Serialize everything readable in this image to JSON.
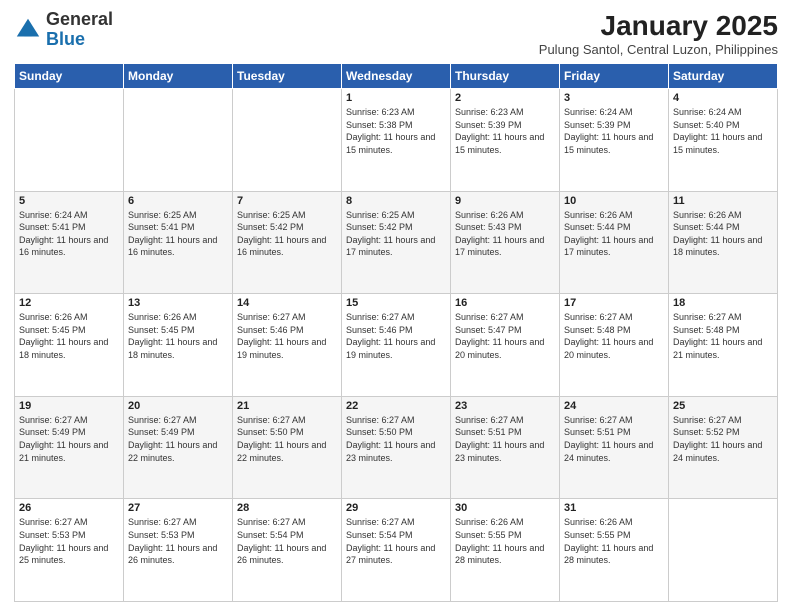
{
  "header": {
    "logo_general": "General",
    "logo_blue": "Blue",
    "month_title": "January 2025",
    "location": "Pulung Santol, Central Luzon, Philippines"
  },
  "weekdays": [
    "Sunday",
    "Monday",
    "Tuesday",
    "Wednesday",
    "Thursday",
    "Friday",
    "Saturday"
  ],
  "weeks": [
    [
      {
        "day": "",
        "info": ""
      },
      {
        "day": "",
        "info": ""
      },
      {
        "day": "",
        "info": ""
      },
      {
        "day": "1",
        "info": "Sunrise: 6:23 AM\nSunset: 5:38 PM\nDaylight: 11 hours and 15 minutes."
      },
      {
        "day": "2",
        "info": "Sunrise: 6:23 AM\nSunset: 5:39 PM\nDaylight: 11 hours and 15 minutes."
      },
      {
        "day": "3",
        "info": "Sunrise: 6:24 AM\nSunset: 5:39 PM\nDaylight: 11 hours and 15 minutes."
      },
      {
        "day": "4",
        "info": "Sunrise: 6:24 AM\nSunset: 5:40 PM\nDaylight: 11 hours and 15 minutes."
      }
    ],
    [
      {
        "day": "5",
        "info": "Sunrise: 6:24 AM\nSunset: 5:41 PM\nDaylight: 11 hours and 16 minutes."
      },
      {
        "day": "6",
        "info": "Sunrise: 6:25 AM\nSunset: 5:41 PM\nDaylight: 11 hours and 16 minutes."
      },
      {
        "day": "7",
        "info": "Sunrise: 6:25 AM\nSunset: 5:42 PM\nDaylight: 11 hours and 16 minutes."
      },
      {
        "day": "8",
        "info": "Sunrise: 6:25 AM\nSunset: 5:42 PM\nDaylight: 11 hours and 17 minutes."
      },
      {
        "day": "9",
        "info": "Sunrise: 6:26 AM\nSunset: 5:43 PM\nDaylight: 11 hours and 17 minutes."
      },
      {
        "day": "10",
        "info": "Sunrise: 6:26 AM\nSunset: 5:44 PM\nDaylight: 11 hours and 17 minutes."
      },
      {
        "day": "11",
        "info": "Sunrise: 6:26 AM\nSunset: 5:44 PM\nDaylight: 11 hours and 18 minutes."
      }
    ],
    [
      {
        "day": "12",
        "info": "Sunrise: 6:26 AM\nSunset: 5:45 PM\nDaylight: 11 hours and 18 minutes."
      },
      {
        "day": "13",
        "info": "Sunrise: 6:26 AM\nSunset: 5:45 PM\nDaylight: 11 hours and 18 minutes."
      },
      {
        "day": "14",
        "info": "Sunrise: 6:27 AM\nSunset: 5:46 PM\nDaylight: 11 hours and 19 minutes."
      },
      {
        "day": "15",
        "info": "Sunrise: 6:27 AM\nSunset: 5:46 PM\nDaylight: 11 hours and 19 minutes."
      },
      {
        "day": "16",
        "info": "Sunrise: 6:27 AM\nSunset: 5:47 PM\nDaylight: 11 hours and 20 minutes."
      },
      {
        "day": "17",
        "info": "Sunrise: 6:27 AM\nSunset: 5:48 PM\nDaylight: 11 hours and 20 minutes."
      },
      {
        "day": "18",
        "info": "Sunrise: 6:27 AM\nSunset: 5:48 PM\nDaylight: 11 hours and 21 minutes."
      }
    ],
    [
      {
        "day": "19",
        "info": "Sunrise: 6:27 AM\nSunset: 5:49 PM\nDaylight: 11 hours and 21 minutes."
      },
      {
        "day": "20",
        "info": "Sunrise: 6:27 AM\nSunset: 5:49 PM\nDaylight: 11 hours and 22 minutes."
      },
      {
        "day": "21",
        "info": "Sunrise: 6:27 AM\nSunset: 5:50 PM\nDaylight: 11 hours and 22 minutes."
      },
      {
        "day": "22",
        "info": "Sunrise: 6:27 AM\nSunset: 5:50 PM\nDaylight: 11 hours and 23 minutes."
      },
      {
        "day": "23",
        "info": "Sunrise: 6:27 AM\nSunset: 5:51 PM\nDaylight: 11 hours and 23 minutes."
      },
      {
        "day": "24",
        "info": "Sunrise: 6:27 AM\nSunset: 5:51 PM\nDaylight: 11 hours and 24 minutes."
      },
      {
        "day": "25",
        "info": "Sunrise: 6:27 AM\nSunset: 5:52 PM\nDaylight: 11 hours and 24 minutes."
      }
    ],
    [
      {
        "day": "26",
        "info": "Sunrise: 6:27 AM\nSunset: 5:53 PM\nDaylight: 11 hours and 25 minutes."
      },
      {
        "day": "27",
        "info": "Sunrise: 6:27 AM\nSunset: 5:53 PM\nDaylight: 11 hours and 26 minutes."
      },
      {
        "day": "28",
        "info": "Sunrise: 6:27 AM\nSunset: 5:54 PM\nDaylight: 11 hours and 26 minutes."
      },
      {
        "day": "29",
        "info": "Sunrise: 6:27 AM\nSunset: 5:54 PM\nDaylight: 11 hours and 27 minutes."
      },
      {
        "day": "30",
        "info": "Sunrise: 6:26 AM\nSunset: 5:55 PM\nDaylight: 11 hours and 28 minutes."
      },
      {
        "day": "31",
        "info": "Sunrise: 6:26 AM\nSunset: 5:55 PM\nDaylight: 11 hours and 28 minutes."
      },
      {
        "day": "",
        "info": ""
      }
    ]
  ]
}
